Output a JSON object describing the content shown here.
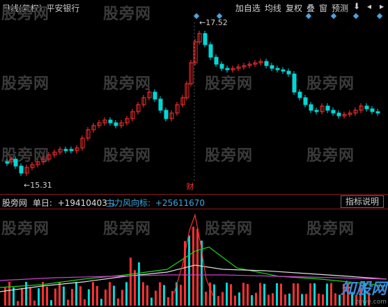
{
  "header": {
    "period": "日线",
    "adjust": "(复权)",
    "stock_name": "平安银行",
    "buttons": {
      "add_watch": "加自选",
      "ma": "均线",
      "reright": "复权",
      "overlay": "叠",
      "window": "窗",
      "forecast": "预测"
    },
    "icons": [
      "down-arrow-icon",
      "left-arrow-icon",
      "right-arrow-icon"
    ]
  },
  "price_labels": {
    "high": "17.52",
    "low": "15.31"
  },
  "event_marker": "财",
  "indicator": {
    "name": "股旁网",
    "single_day_label": "单日:",
    "single_day_value": "+19410403",
    "arrow": "↓",
    "main_label": "主力风向标:",
    "main_value": "+25611670",
    "help_button": "指标说明"
  },
  "watermark": "股旁网",
  "logo": {
    "text": "知股网",
    "url": "zgwe.com"
  },
  "colors": {
    "up": "#ff3030",
    "down": "#00d8d8",
    "bg": "#000000",
    "line_green": "#18d818",
    "line_white": "#e0e0e0",
    "line_magenta": "#d040d0"
  }
}
